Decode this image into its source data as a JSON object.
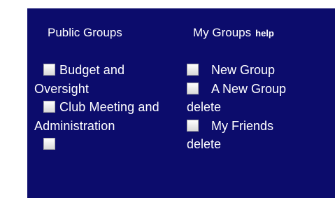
{
  "public_groups": {
    "title": "Public Groups",
    "items": [
      {
        "label": "Budget and Oversight"
      },
      {
        "label": "Club Meeting and Administration"
      },
      {
        "label": ""
      }
    ]
  },
  "my_groups": {
    "title": "My Groups",
    "help_label": "help",
    "items": [
      {
        "label": "New Group",
        "delete_label": ""
      },
      {
        "label": "A New Group",
        "delete_label": "delete"
      },
      {
        "label": "My Friends",
        "delete_label": "delete"
      }
    ]
  },
  "colors": {
    "panel_background": "#0c0c6c",
    "text": "#ffffff"
  }
}
